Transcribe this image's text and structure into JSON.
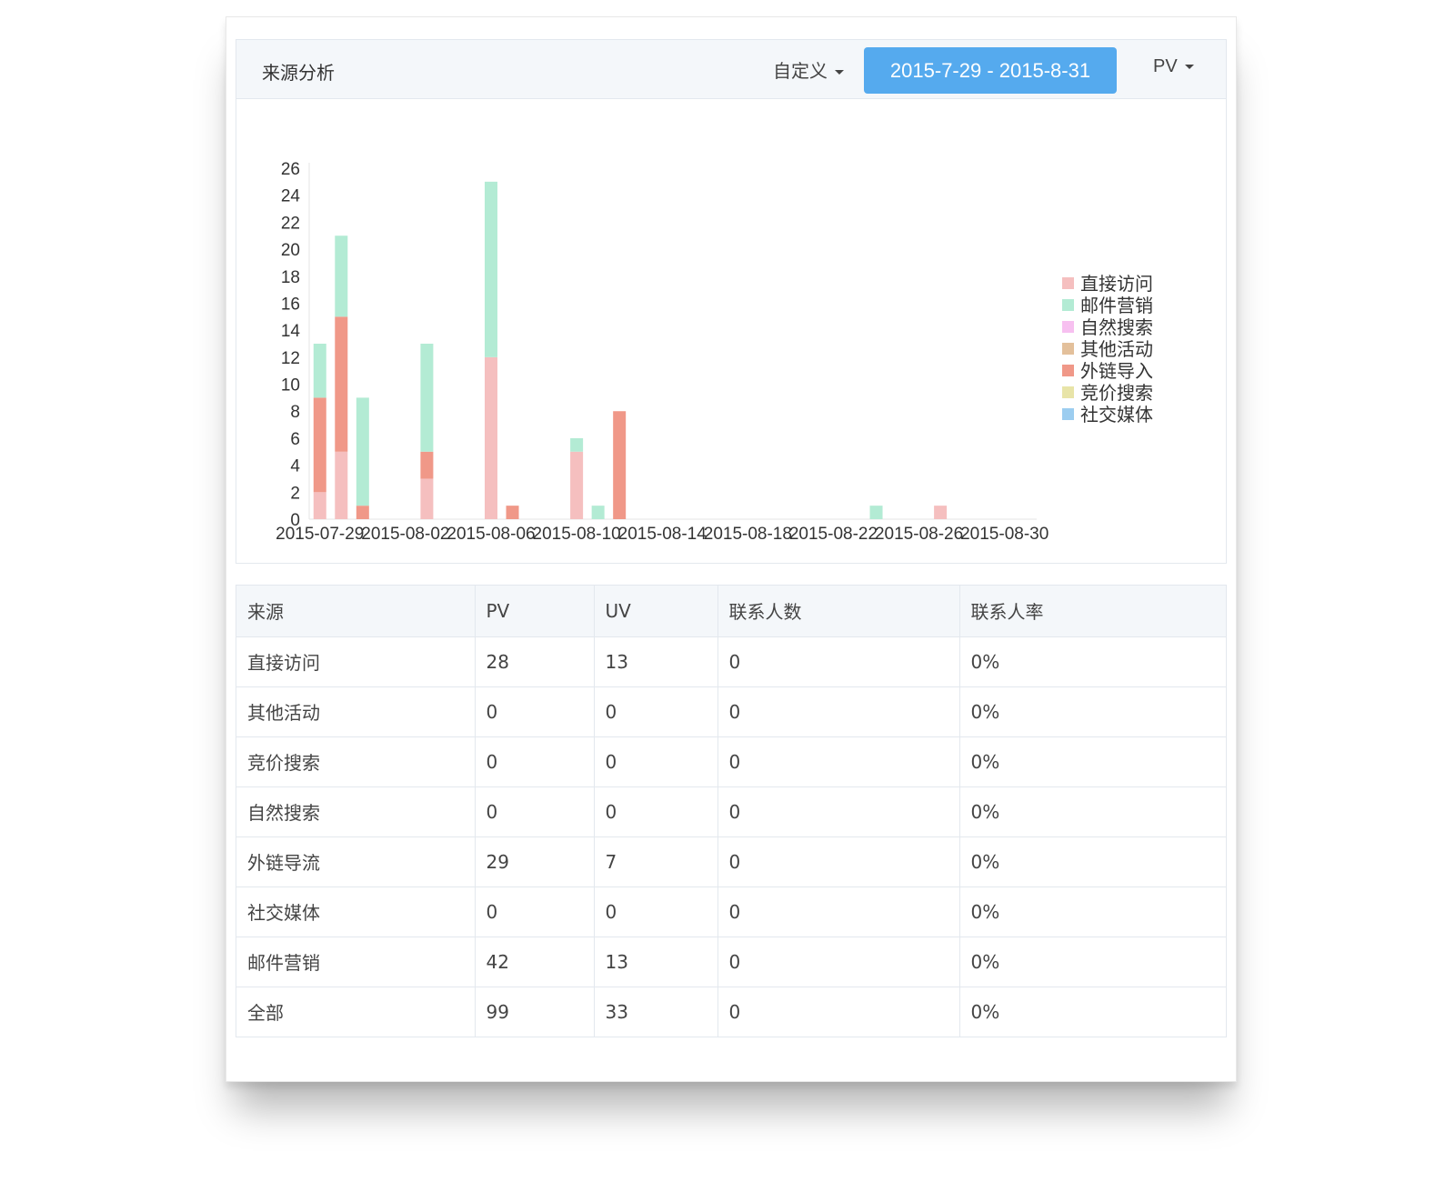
{
  "header": {
    "title": "来源分析",
    "range_mode": "自定义",
    "date_range": "2015-7-29 - 2015-8-31",
    "metric": "PV"
  },
  "chart_data": {
    "type": "bar",
    "stacked": true,
    "x_axis": {
      "start": "2015-07-29",
      "end": "2015-08-31"
    },
    "x_tick_labels": [
      "2015-07-29",
      "2015-08-02",
      "2015-08-06",
      "2015-08-10",
      "2015-08-14",
      "2015-08-18",
      "2015-08-22",
      "2015-08-26",
      "2015-08-30"
    ],
    "y_tick_labels": [
      "0",
      "2",
      "4",
      "6",
      "8",
      "10",
      "12",
      "14",
      "16",
      "18",
      "20",
      "22",
      "24",
      "26"
    ],
    "ylim": [
      0,
      26
    ],
    "legend_position": "right",
    "legend": [
      "直接访问",
      "邮件营销",
      "自然搜索",
      "其他活动",
      "外链导入",
      "竞价搜索",
      "社交媒体"
    ],
    "colors": {
      "直接访问": "#f5bfbf",
      "邮件营销": "#b3ebd4",
      "自然搜索": "#f7c0f0",
      "其他活动": "#e3c09b",
      "外链导入": "#f09888",
      "竞价搜索": "#e8e4a8",
      "社交媒体": "#9ccdf0"
    },
    "bars": [
      {
        "date": "2015-07-29",
        "stack": [
          {
            "series": "直接访问",
            "value": 2
          },
          {
            "series": "外链导入",
            "value": 7
          },
          {
            "series": "邮件营销",
            "value": 4
          }
        ]
      },
      {
        "date": "2015-07-30",
        "stack": [
          {
            "series": "直接访问",
            "value": 5
          },
          {
            "series": "外链导入",
            "value": 10
          },
          {
            "series": "邮件营销",
            "value": 6
          }
        ]
      },
      {
        "date": "2015-07-31",
        "stack": [
          {
            "series": "外链导入",
            "value": 1
          },
          {
            "series": "邮件营销",
            "value": 8
          }
        ]
      },
      {
        "date": "2015-08-03",
        "stack": [
          {
            "series": "直接访问",
            "value": 3
          },
          {
            "series": "外链导入",
            "value": 2
          },
          {
            "series": "邮件营销",
            "value": 8
          }
        ]
      },
      {
        "date": "2015-08-06",
        "stack": [
          {
            "series": "直接访问",
            "value": 12
          },
          {
            "series": "邮件营销",
            "value": 13
          }
        ]
      },
      {
        "date": "2015-08-07",
        "stack": [
          {
            "series": "外链导入",
            "value": 1
          }
        ]
      },
      {
        "date": "2015-08-10",
        "stack": [
          {
            "series": "直接访问",
            "value": 5
          },
          {
            "series": "邮件营销",
            "value": 1
          }
        ]
      },
      {
        "date": "2015-08-11",
        "stack": [
          {
            "series": "邮件营销",
            "value": 1
          }
        ]
      },
      {
        "date": "2015-08-12",
        "stack": [
          {
            "series": "外链导入",
            "value": 8
          }
        ]
      },
      {
        "date": "2015-08-24",
        "stack": [
          {
            "series": "邮件营销",
            "value": 1
          }
        ]
      },
      {
        "date": "2015-08-27",
        "stack": [
          {
            "series": "直接访问",
            "value": 1
          }
        ]
      }
    ]
  },
  "table": {
    "columns": [
      "来源",
      "PV",
      "UV",
      "联系人数",
      "联系人率"
    ],
    "rows": [
      [
        "直接访问",
        "28",
        "13",
        "0",
        "0%"
      ],
      [
        "其他活动",
        "0",
        "0",
        "0",
        "0%"
      ],
      [
        "竞价搜索",
        "0",
        "0",
        "0",
        "0%"
      ],
      [
        "自然搜索",
        "0",
        "0",
        "0",
        "0%"
      ],
      [
        "外链导流",
        "29",
        "7",
        "0",
        "0%"
      ],
      [
        "社交媒体",
        "0",
        "0",
        "0",
        "0%"
      ],
      [
        "邮件营销",
        "42",
        "13",
        "0",
        "0%"
      ],
      [
        "全部",
        "99",
        "33",
        "0",
        "0%"
      ]
    ]
  }
}
